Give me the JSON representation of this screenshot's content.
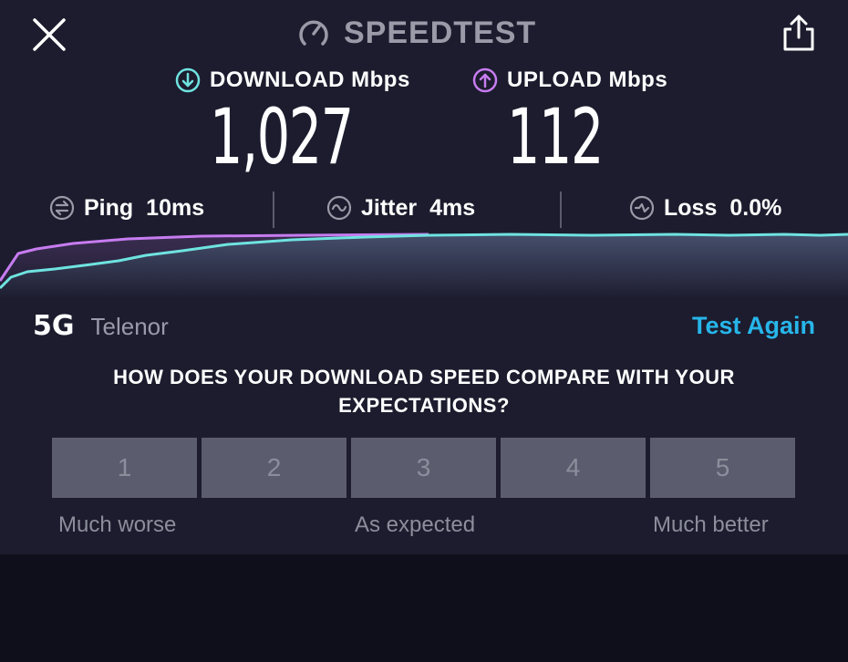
{
  "header": {
    "title": "SPEEDTEST",
    "logo_icon": "speedometer-icon",
    "close_icon": "close-icon",
    "share_icon": "share-icon"
  },
  "results": {
    "download": {
      "label": "DOWNLOAD Mbps",
      "value": "1,027",
      "icon": "arrow-down-circle-icon",
      "color": "#6fe3e0"
    },
    "upload": {
      "label": "UPLOAD Mbps",
      "value": "112",
      "icon": "arrow-up-circle-icon",
      "color": "#c77cf0"
    }
  },
  "stats": {
    "ping": {
      "label": "Ping",
      "value": "10ms",
      "icon": "ping-icon"
    },
    "jitter": {
      "label": "Jitter",
      "value": "4ms",
      "icon": "jitter-icon"
    },
    "loss": {
      "label": "Loss",
      "value": "0.0%",
      "icon": "loss-icon"
    }
  },
  "network": {
    "type": "5G",
    "carrier": "Telenor"
  },
  "actions": {
    "test_again": "Test Again"
  },
  "survey": {
    "question": "HOW DOES YOUR DOWNLOAD SPEED COMPARE WITH YOUR EXPECTATIONS?",
    "options": [
      "1",
      "2",
      "3",
      "4",
      "5"
    ],
    "labels": {
      "low": "Much worse",
      "mid": "As expected",
      "high": "Much better"
    }
  },
  "colors": {
    "background": "#1c1c2e",
    "download": "#6fe3e0",
    "upload": "#c77cf0",
    "accent": "#27b6ea",
    "rating_button": "#5b5c6e"
  }
}
